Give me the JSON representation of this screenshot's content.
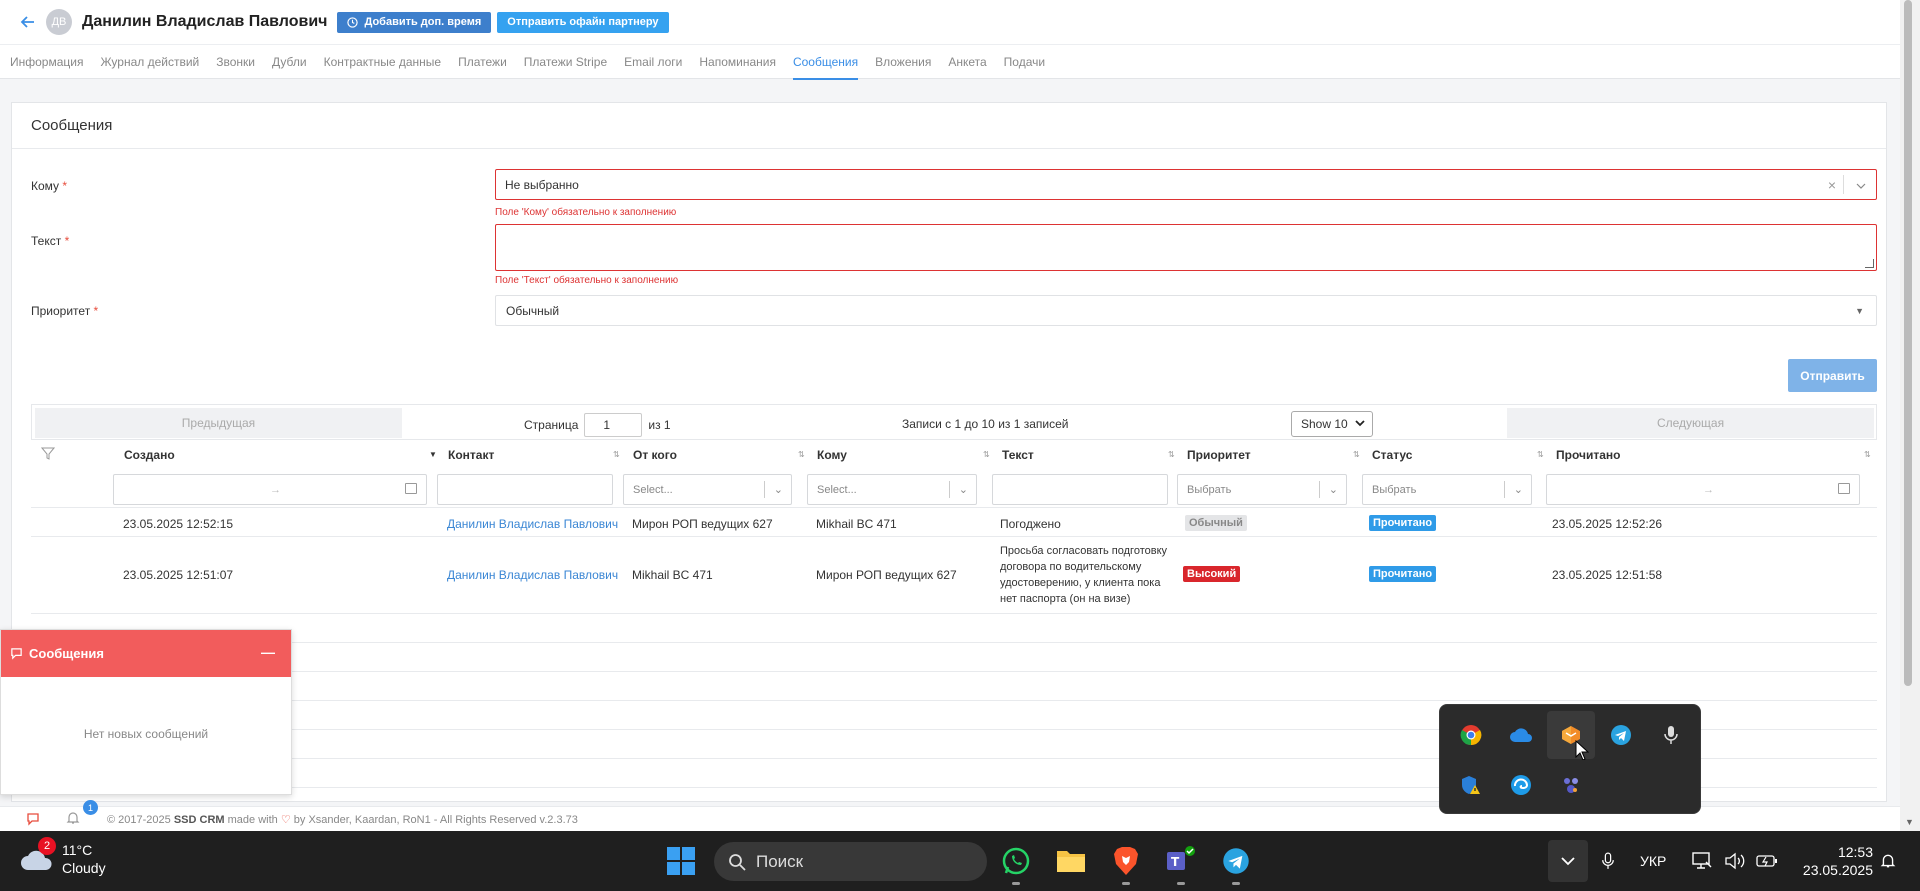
{
  "header": {
    "avatar_initials": "ДВ",
    "client_name": "Данилин Владислав Павлович",
    "add_time_label": "Добавить доп. время",
    "send_offer_label": "Отправить офайн партнеру"
  },
  "tabs": [
    {
      "label": "Информация"
    },
    {
      "label": "Журнал действий"
    },
    {
      "label": "Звонки"
    },
    {
      "label": "Дубли"
    },
    {
      "label": "Контрактные данные"
    },
    {
      "label": "Платежи"
    },
    {
      "label": "Платежи Stripe"
    },
    {
      "label": "Email логи"
    },
    {
      "label": "Напоминания"
    },
    {
      "label": "Сообщения"
    },
    {
      "label": "Вложения"
    },
    {
      "label": "Анкета"
    },
    {
      "label": "Подачи"
    }
  ],
  "card": {
    "title": "Сообщения",
    "to_label": "Кому",
    "to_value": "Не выбранно",
    "to_error": "Поле 'Кому' обязательно к заполнению",
    "text_label": "Текст",
    "text_error": "Поле 'Текст' обязательно к заполнению",
    "priority_label": "Приоритет",
    "priority_value": "Обычный",
    "required_mark": "*",
    "send_label": "Отправить"
  },
  "pager": {
    "prev_label": "Предыдущая",
    "page_label": "Страница",
    "page_value": "1",
    "of_label": "из 1",
    "records_info": "Записи с 1 до 10 из 1 записей",
    "show_value": "Show 10",
    "next_label": "Следующая"
  },
  "table": {
    "columns": [
      "Создано",
      "Контакт",
      "От кого",
      "Кому",
      "Текст",
      "Приоритет",
      "Статус",
      "Прочитано"
    ],
    "filters": {
      "from_placeholder": "Select...",
      "to_placeholder": "Select...",
      "priority_placeholder": "Выбрать",
      "status_placeholder": "Выбрать",
      "range_arrow": "→"
    },
    "rows": [
      {
        "created": "23.05.2025 12:52:15",
        "contact": "Данилин Владислав Павлович",
        "from": "Мирон РОП ведущих 627",
        "to": "Mikhail BC 471",
        "text": "Погоджено",
        "priority": "Обычный",
        "status": "Прочитано",
        "read": "23.05.2025 12:52:26"
      },
      {
        "created": "23.05.2025 12:51:07",
        "contact": "Данилин Владислав Павлович",
        "from": "Mikhail BC 471",
        "to": "Мирон РОП ведущих 627",
        "text": "Просьба согласовать подготовку договора по водительскому удостоверению, у клиента пока нет паспорта (он на визе)",
        "priority": "Высокий",
        "status": "Прочитано",
        "read": "23.05.2025 12:51:58"
      }
    ]
  },
  "messages_widget": {
    "title": "Сообщения",
    "empty_text": "Нет новых сообщений"
  },
  "footer": {
    "copyright": "© 2017-2025",
    "brand": "SSD CRM",
    "made_with": "made with",
    "credits": "by Xsander, Kaardan, RoN1 - All Rights Reserved v.2.3.73",
    "notif_count": "1"
  },
  "taskbar": {
    "weather_badge": "2",
    "temperature": "11°C",
    "weather_desc": "Cloudy",
    "search_placeholder": "Поиск",
    "lang": "УКР",
    "time": "12:53",
    "date": "23.05.2025"
  },
  "colors": {
    "accent": "#3a8ee6",
    "error": "#dd3333",
    "widget_red": "#f25c5c",
    "badge_high": "#d9262c",
    "badge_read": "#2f9be8"
  }
}
